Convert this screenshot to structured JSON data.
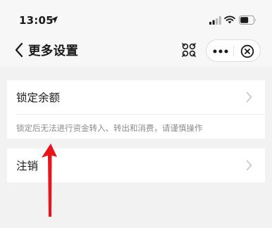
{
  "status_bar": {
    "time": "13:05",
    "icons": [
      "location-arrow-icon",
      "signal-icon",
      "wifi-icon",
      "battery-icon"
    ]
  },
  "nav": {
    "title": "更多设置",
    "back_icon": "chevron-left-icon",
    "actions": [
      "scan-icon",
      "more-icon",
      "close-icon"
    ]
  },
  "settings": {
    "lock_balance": {
      "label": "锁定余额",
      "description": "锁定后无法进行资金转入、转出和消费，请谨慎操作"
    },
    "deregister": {
      "label": "注销"
    }
  },
  "annotation": {
    "type": "arrow",
    "color": "#e8141a",
    "points_to": "deregister"
  },
  "colors": {
    "background": "#f2f2f2",
    "header": "#f7f7f7",
    "card": "#ffffff",
    "secondary_text": "#8c8c8c",
    "chevron": "#c4c4c4"
  }
}
